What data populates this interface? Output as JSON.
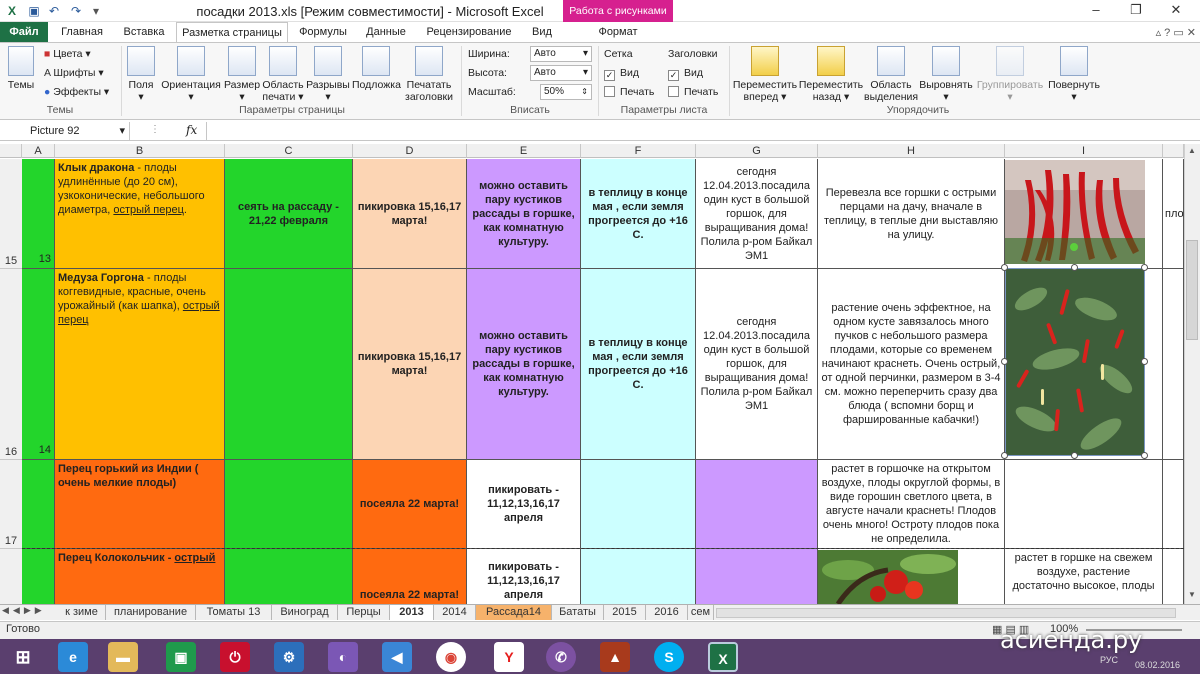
{
  "window": {
    "title": "посадки 2013.xls  [Режим совместимости]  -  Microsoft Excel",
    "context_tab_group": "Работа с рисунками"
  },
  "tabs": [
    {
      "label": "Файл"
    },
    {
      "label": "Главная"
    },
    {
      "label": "Вставка"
    },
    {
      "label": "Разметка страницы"
    },
    {
      "label": "Формулы"
    },
    {
      "label": "Данные"
    },
    {
      "label": "Рецензирование"
    },
    {
      "label": "Вид"
    },
    {
      "label": "Формат"
    }
  ],
  "ribbon": {
    "themes": {
      "temy": "Темы",
      "cveta": "Цвета",
      "shrifty": "Шрифты",
      "effekty": "Эффекты",
      "group": "Темы"
    },
    "page_setup": {
      "polya": "Поля",
      "orientaciya": "Ориентация",
      "razmer": "Размер",
      "oblast": "Область",
      "pechati": "печати",
      "razryvy": "Разрывы",
      "podlozhka": "Подложка",
      "pechatat": "Печатать",
      "zagolovki": "заголовки",
      "group": "Параметры страницы"
    },
    "fit": {
      "shirina": "Ширина:",
      "shirina_val": "Авто",
      "vysota": "Высота:",
      "vysota_val": "Авто",
      "masshtab": "Масштаб:",
      "masshtab_val": "50%",
      "group": "Вписать"
    },
    "sheet_options": {
      "setka": "Сетка",
      "zagolovki": "Заголовки",
      "vid": "Вид",
      "pechat": "Печать",
      "group": "Параметры листа"
    },
    "arrange": {
      "vpered1": "Переместить",
      "vpered2": "вперед",
      "nazad1": "Переместить",
      "nazad2": "назад",
      "oblast1": "Область",
      "oblast2": "выделения",
      "vyrovnyat": "Выровнять",
      "gruppirovat": "Группировать",
      "povernut": "Повернуть",
      "group": "Упорядочить"
    }
  },
  "formula_bar": {
    "name_box": "Picture 92",
    "fx": "fx",
    "value": ""
  },
  "columns": [
    "A",
    "B",
    "C",
    "D",
    "E",
    "F",
    "G",
    "H",
    "I"
  ],
  "rows": [
    {
      "num": "15",
      "a": "13",
      "b_title": "Клык дракона",
      "b_text": " - плоды удлинённые (до 20 см), узкоконические, небольшого диаметра, ",
      "b_link": "острый перец",
      "b_tail": ".",
      "c": "сеять на рассаду - 21,22 февраля",
      "d": "пикировка 15,16,17 марта!",
      "e": "можно оставить пару кустиков рассады в горшке, как комнатную культуру.",
      "f": "в теплицу в конце мая , если земля прогреется до +16 С.",
      "g": "сегодня 12.04.2013.посадила один куст в большой горшок, для выращивания дома! Полила р-ром Байкал ЭМ1",
      "h": "Перевезла все горшки с острыми перцами на дачу, вначале в теплицу, в теплые дни выставляю на улицу.",
      "j": "пло"
    },
    {
      "num": "16",
      "a": "14",
      "b_title": "Медуза Горгона",
      "b_text": " - плоды коггевидные, красные, очень урожайный (как шапка), ",
      "b_link": "острый перец",
      "b_tail": "",
      "c": "",
      "d": "пикировка 15,16,17 марта!",
      "e": "можно оставить пару кустиков рассады в горшке, как комнатную культуру.",
      "f": "в теплицу в конце мая , если земля прогреется до +16 С.",
      "g": "сегодня 12.04.2013.посадила один куст в большой горшок, для выращивания дома! Полила р-ром Байкал ЭМ1",
      "h": "растение очень эффектное, на одном кусте завязалось много пучков с небольшого размера плодами, которые со временем начинают краснеть. Очень острый, от одной перчинки, размером в 3-4 см. можно переперчить сразу два блюда ( вспомни борщ и фаршированные кабачки!)"
    },
    {
      "num": "17",
      "a": "",
      "b_title": "Перец горький из Индии ( очень мелкие плоды)",
      "d": "посеяла 22 марта!",
      "e": "пикировать - 11,12,13,16,17 апреля",
      "h": "растет в горшочке на открытом воздухе, плоды округлой формы, в виде горошин светлого цвета, в августе начали краснеть! Плодов очень много! Остроту плодов пока не определила."
    },
    {
      "num": "",
      "a": "",
      "b_title": "Перец Колокольчик - ",
      "b_link": "острый",
      "d": "посеяла 22 марта!",
      "e": "пикировать - 11,12,13,16,17 апреля",
      "i": "растет в горшке на свежем воздухе, растение достаточно высокое, плоды"
    }
  ],
  "sheet_tabs": [
    "к зиме",
    "планирование",
    "Томаты 13",
    "Виноград",
    "Перцы",
    "2013",
    "2014",
    "Рассада14",
    "Бататы",
    "2015",
    "2016",
    "сем"
  ],
  "status": {
    "ready": "Готово",
    "zoom": "100%"
  },
  "watermark": "асиенда.ру",
  "clock": {
    "date": "08.02.2016",
    "lang": "РУС"
  }
}
